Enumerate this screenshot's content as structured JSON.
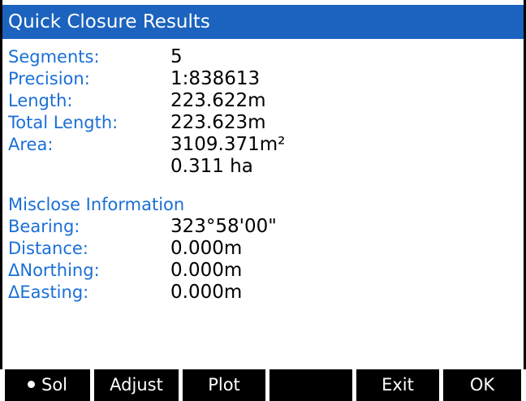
{
  "window": {
    "title": "Quick Closure Results"
  },
  "summary": [
    {
      "label": "Segments:",
      "value": "5"
    },
    {
      "label": "Precision:",
      "value": "1:838613"
    },
    {
      "label": "Length:",
      "value": "223.622m"
    },
    {
      "label": "Total Length:",
      "value": "223.623m"
    },
    {
      "label": "Area:",
      "value": "3109.371m²"
    },
    {
      "label": "",
      "value": "0.311 ha"
    }
  ],
  "misclose": {
    "heading": "Misclose Information",
    "rows": [
      {
        "label": "Bearing:",
        "value": "323°58'00\""
      },
      {
        "label": "Distance:",
        "value": "0.000m"
      },
      {
        "label": "ΔNorthing:",
        "value": "0.000m"
      },
      {
        "label": "ΔEasting:",
        "value": "0.000m"
      }
    ]
  },
  "softkeys": {
    "sol": "Sol",
    "adjust": "Adjust",
    "plot": "Plot",
    "empty": "",
    "exit": "Exit",
    "ok": "OK"
  },
  "colors": {
    "title_bar": "#1b63be",
    "label_text": "#1a6fd6",
    "value_text": "#000000",
    "softkey_bg": "#000000",
    "softkey_text": "#ffffff"
  }
}
